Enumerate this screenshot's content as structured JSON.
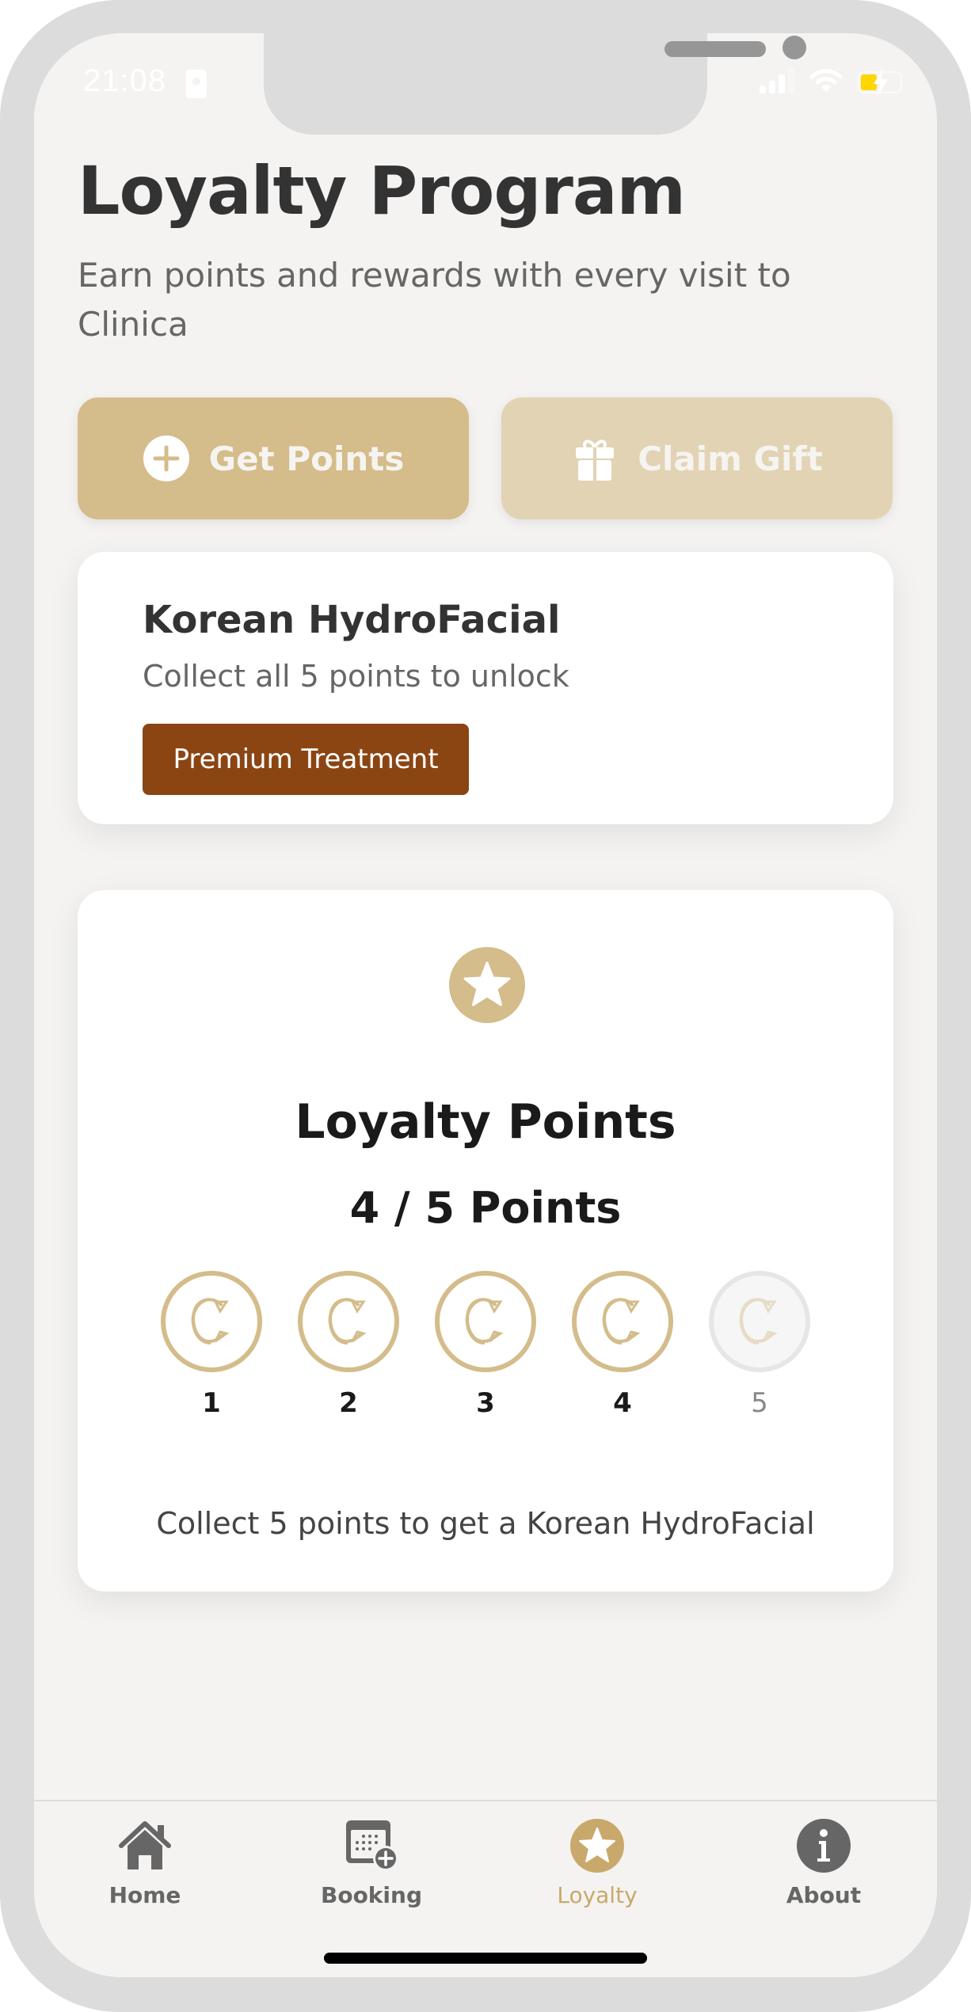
{
  "status_bar": {
    "time": "21:08",
    "icons": [
      "id-badge-icon",
      "signal-icon",
      "wifi-icon",
      "battery-charging-icon"
    ]
  },
  "header": {
    "title": "Loyalty Program",
    "subtitle": "Earn points and rewards with every visit to Clinica"
  },
  "actions": {
    "get_points_label": "Get Points",
    "get_points_icon": "plus-circle-icon",
    "claim_gift_label": "Claim Gift",
    "claim_gift_icon": "gift-icon"
  },
  "reward": {
    "title": "Korean HydroFacial",
    "description": "Collect all 5 points to unlock",
    "badge": "Premium Treatment"
  },
  "points": {
    "icon": "star-icon",
    "title": "Loyalty Points",
    "earned": 4,
    "total": 5,
    "count_text": "4 / 5 Points",
    "coins": [
      {
        "label": "1",
        "collected": true
      },
      {
        "label": "2",
        "collected": true
      },
      {
        "label": "3",
        "collected": true
      },
      {
        "label": "4",
        "collected": true
      },
      {
        "label": "5",
        "collected": false
      }
    ],
    "footer": "Collect 5 points to get a Korean HydroFacial"
  },
  "tab_bar": {
    "active": "Loyalty",
    "tabs": [
      {
        "label": "Home",
        "icon": "home-icon"
      },
      {
        "label": "Booking",
        "icon": "calendar-add-icon"
      },
      {
        "label": "Loyalty",
        "icon": "star-circle-icon"
      },
      {
        "label": "About",
        "icon": "info-circle-icon"
      }
    ]
  },
  "colors": {
    "accent": "#d4bc8b",
    "accent_light": "#e1d3b4",
    "badge": "#8b4513",
    "background": "#f4f3f1",
    "tab_active": "#c8a96b",
    "tab_inactive": "#666666"
  }
}
